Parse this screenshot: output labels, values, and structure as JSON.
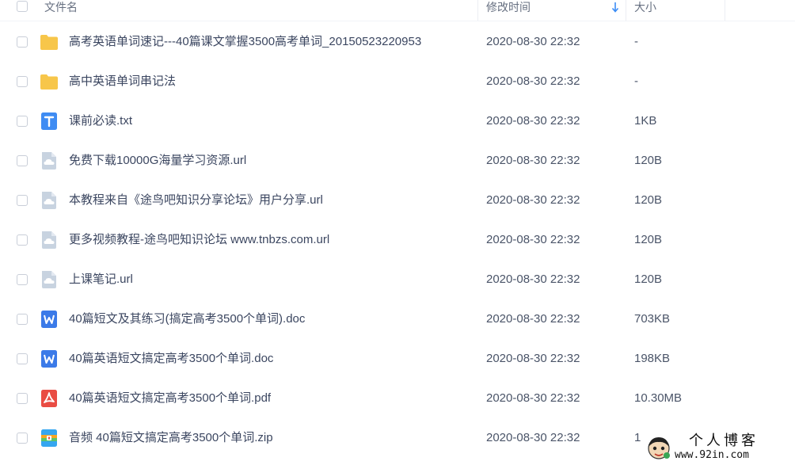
{
  "header": {
    "col_name": "文件名",
    "col_modified": "修改时间",
    "col_size": "大小"
  },
  "files": [
    {
      "name": "高考英语单词速记---40篇课文掌握3500高考单词_20150523220953",
      "modified": "2020-08-30 22:32",
      "size": "-",
      "icon": "folder-icon"
    },
    {
      "name": "高中英语单词串记法",
      "modified": "2020-08-30 22:32",
      "size": "-",
      "icon": "folder-icon"
    },
    {
      "name": "课前必读.txt",
      "modified": "2020-08-30 22:32",
      "size": "1KB",
      "icon": "txt-file-icon"
    },
    {
      "name": "免费下载10000G海量学习资源.url",
      "modified": "2020-08-30 22:32",
      "size": "120B",
      "icon": "url-file-icon"
    },
    {
      "name": "本教程来自《途鸟吧知识分享论坛》用户分享.url",
      "modified": "2020-08-30 22:32",
      "size": "120B",
      "icon": "url-file-icon"
    },
    {
      "name": "更多视频教程-途鸟吧知识论坛 www.tnbzs.com.url",
      "modified": "2020-08-30 22:32",
      "size": "120B",
      "icon": "url-file-icon"
    },
    {
      "name": "上课笔记.url",
      "modified": "2020-08-30 22:32",
      "size": "120B",
      "icon": "url-file-icon"
    },
    {
      "name": "40篇短文及其练习(搞定高考3500个单词).doc",
      "modified": "2020-08-30 22:32",
      "size": "703KB",
      "icon": "word-file-icon"
    },
    {
      "name": "40篇英语短文搞定高考3500个单词.doc",
      "modified": "2020-08-30 22:32",
      "size": "198KB",
      "icon": "word-file-icon"
    },
    {
      "name": "40篇英语短文搞定高考3500个单词.pdf",
      "modified": "2020-08-30 22:32",
      "size": "10.30MB",
      "icon": "pdf-file-icon"
    },
    {
      "name": "音频 40篇短文搞定高考3500个单词.zip",
      "modified": "2020-08-30 22:32",
      "size": "1",
      "icon": "zip-file-icon"
    }
  ],
  "watermark": {
    "title": "个人博客",
    "url": "www.92in.com"
  },
  "colors": {
    "folder": "#f7c64a",
    "txt": "#3f8cf3",
    "url": "#c8d3e0",
    "word": "#3b7ae8",
    "pdf": "#e94c43",
    "zip": "#35a6f0"
  }
}
